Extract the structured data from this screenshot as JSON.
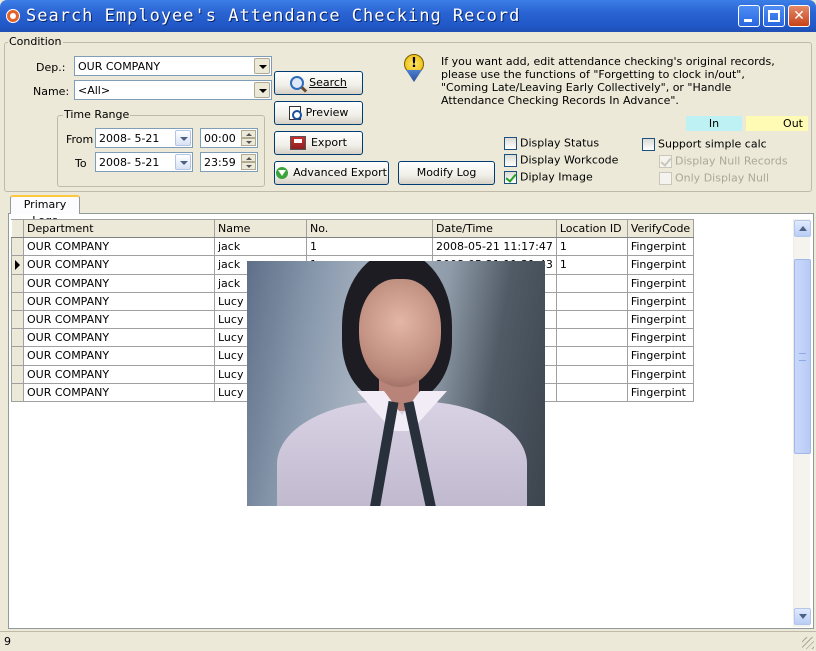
{
  "window": {
    "title": "Search Employee's Attendance Checking Record"
  },
  "condition": {
    "group_label": "Condition",
    "dep_label": "Dep.:",
    "dep_value": "OUR COMPANY",
    "name_label": "Name:",
    "name_value": "<All>",
    "time_range_label": "Time Range",
    "from_label": "From",
    "from_date": "2008- 5-21",
    "from_time": "00:00",
    "to_label": "To",
    "to_date": "2008- 5-21",
    "to_time": "23:59"
  },
  "buttons": {
    "search": "Search",
    "preview": "Preview",
    "export": "Export",
    "advanced_export": "Advanced Export",
    "modify_log": "Modify Log"
  },
  "info_text": "If you want add, edit attendance checking's original records, please use the functions of \"Forgetting to clock in/out\", \"Coming Late/Leaving Early Collectively\", or \"Handle Attendance Checking Records In Advance\".",
  "legend": {
    "in": "In",
    "out": "Out",
    "in_color": "#bdf1f3",
    "out_color": "#fffbb5"
  },
  "options": {
    "display_status": {
      "label": "Display Status",
      "checked": false
    },
    "display_workcode": {
      "label": "Display Workcode",
      "checked": false
    },
    "display_image": {
      "label": "Diplay Image",
      "checked": true
    },
    "support_simple_calc": {
      "label": "Support simple calc",
      "checked": false
    },
    "display_null_records": {
      "label": "Display Null Records",
      "checked": true,
      "disabled": true
    },
    "only_display_null": {
      "label": "Only Display Null",
      "checked": false,
      "disabled": true
    }
  },
  "tabs": [
    {
      "label": "Primary Logs",
      "active": true
    }
  ],
  "grid": {
    "columns": [
      "Department",
      "Name",
      "No.",
      "Date/Time",
      "Location ID",
      "VerifyCode"
    ],
    "current_row": 1,
    "rows": [
      [
        "OUR COMPANY",
        "jack",
        "1",
        "2008-05-21 11:17:47",
        "1",
        "Fingerpint"
      ],
      [
        "OUR COMPANY",
        "jack",
        "1",
        "2008-05-21 11:21:43",
        "1",
        "Fingerpint"
      ],
      [
        "OUR COMPANY",
        "jack",
        "",
        "",
        "",
        "Fingerpint"
      ],
      [
        "OUR COMPANY",
        "Lucy",
        "",
        "",
        "",
        "Fingerpint"
      ],
      [
        "OUR COMPANY",
        "Lucy",
        "",
        "",
        "",
        "Fingerpint"
      ],
      [
        "OUR COMPANY",
        "Lucy",
        "",
        "",
        "",
        "Fingerpint"
      ],
      [
        "OUR COMPANY",
        "Lucy",
        "",
        "",
        "",
        "Fingerpint"
      ],
      [
        "OUR COMPANY",
        "Lucy",
        "",
        "",
        "",
        "Fingerpint"
      ],
      [
        "OUR COMPANY",
        "Lucy",
        "",
        "",
        "",
        "Fingerpint"
      ]
    ]
  },
  "status_bar": {
    "record_count": "9"
  }
}
